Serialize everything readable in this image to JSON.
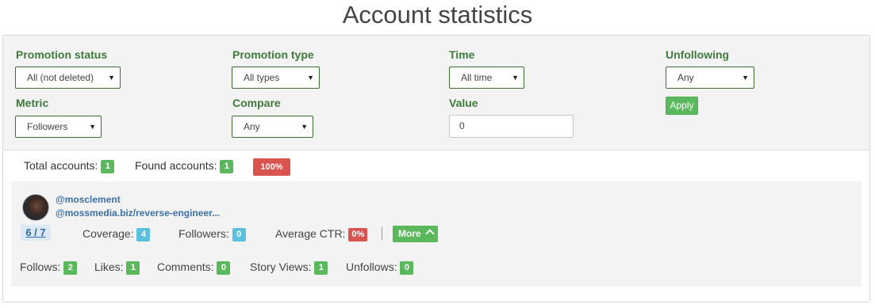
{
  "page": {
    "title": "Account statistics"
  },
  "filters": {
    "promotion_status": {
      "label": "Promotion status",
      "value": "All (not deleted)"
    },
    "promotion_type": {
      "label": "Promotion type",
      "value": "All types"
    },
    "time": {
      "label": "Time",
      "value": "All time"
    },
    "unfollowing": {
      "label": "Unfollowing",
      "value": "Any"
    },
    "metric": {
      "label": "Metric",
      "value": "Followers"
    },
    "compare": {
      "label": "Compare",
      "value": "Any"
    },
    "value": {
      "label": "Value",
      "value": "0"
    },
    "apply_label": "Apply"
  },
  "summary": {
    "total_label": "Total accounts:",
    "total_count": "1",
    "found_label": "Found accounts:",
    "found_count": "1",
    "percent": "100%"
  },
  "account": {
    "username": "@mosclement",
    "link": "@mossmedia.biz/reverse-engineer...",
    "ratio": "6 / 7",
    "coverage_label": "Coverage:",
    "coverage": "4",
    "followers_label": "Followers:",
    "followers": "0",
    "ctr_label": "Average CTR:",
    "ctr": "0%",
    "more_label": "More",
    "follows_label": "Follows:",
    "follows": "2",
    "likes_label": "Likes:",
    "likes": "1",
    "comments_label": "Comments:",
    "comments": "0",
    "story_views_label": "Story Views:",
    "story_views": "1",
    "unfollows_label": "Unfollows:",
    "unfollows": "0"
  },
  "colors": {
    "green": "#5cb85c",
    "blue": "#5bc0de",
    "red": "#d9534f",
    "label_green": "#3e7a3b",
    "link_blue": "#3a6fa8"
  },
  "icons": {
    "dropdown": "caret-down-icon",
    "more": "chevron-up-icon"
  }
}
